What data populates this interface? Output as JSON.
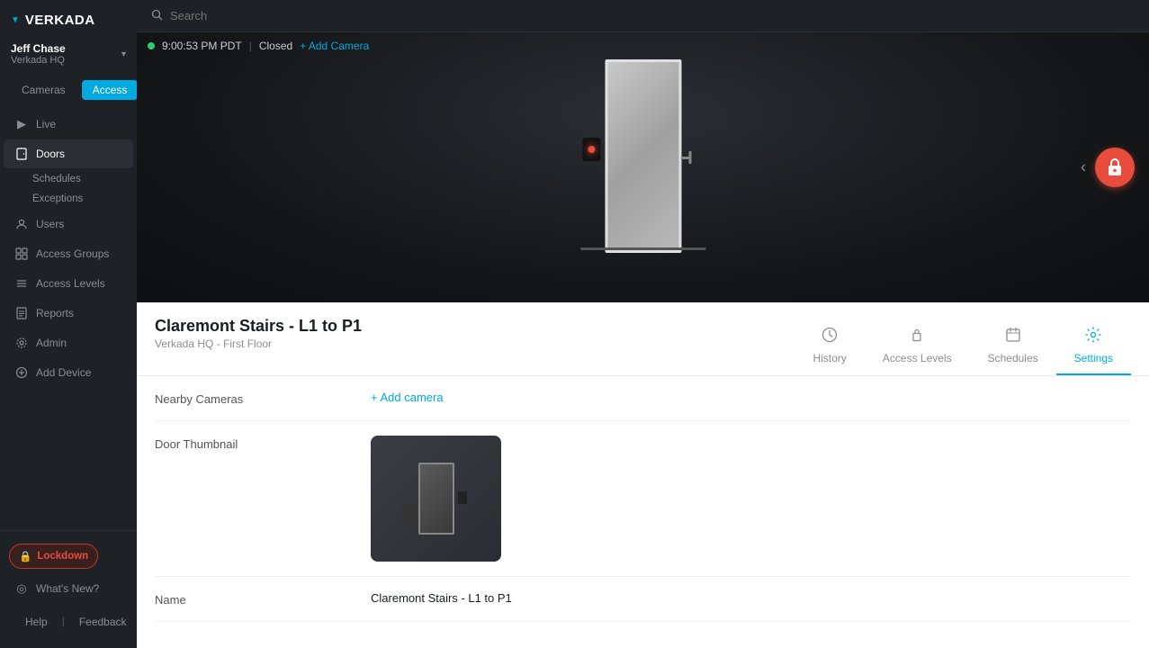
{
  "brand": {
    "name": "VERKADA",
    "logo_symbol": "▼"
  },
  "user": {
    "name": "Jeff Chase",
    "org": "Verkada HQ",
    "chevron": "▾"
  },
  "mode_buttons": {
    "cameras": "Cameras",
    "access": "Access"
  },
  "sidebar": {
    "nav_items": [
      {
        "id": "live",
        "label": "Live",
        "icon": "▶"
      },
      {
        "id": "doors",
        "label": "Doors",
        "icon": "🚪",
        "active": true
      },
      {
        "id": "schedules",
        "label": "Schedules",
        "sub": true
      },
      {
        "id": "exceptions",
        "label": "Exceptions",
        "sub": true
      },
      {
        "id": "users",
        "label": "Users",
        "icon": "👤"
      },
      {
        "id": "access-groups",
        "label": "Access Groups",
        "icon": "⊞"
      },
      {
        "id": "access-levels",
        "label": "Access Levels",
        "icon": "≡"
      },
      {
        "id": "reports",
        "label": "Reports",
        "icon": "📄"
      },
      {
        "id": "admin",
        "label": "Admin",
        "icon": "⚙"
      },
      {
        "id": "add-device",
        "label": "Add Device",
        "icon": "+"
      }
    ],
    "bottom_items": [
      {
        "id": "whats-new",
        "label": "What's New?",
        "icon": "◎"
      },
      {
        "id": "help",
        "label": "Help",
        "icon": "?"
      },
      {
        "id": "feedback",
        "label": "Feedback",
        "icon": "✉"
      }
    ],
    "lockdown_label": "Lockdown"
  },
  "header": {
    "search_placeholder": "Search"
  },
  "status_bar": {
    "time": "9:00:53 PM PDT",
    "separator": "|",
    "status": "Closed",
    "add_camera": "+ Add Camera"
  },
  "detail": {
    "door_name": "Claremont Stairs - L1 to P1",
    "location": "Verkada HQ - First Floor",
    "tabs": [
      {
        "id": "history",
        "label": "History",
        "icon": "🕐"
      },
      {
        "id": "access-levels",
        "label": "Access Levels",
        "icon": "🔒"
      },
      {
        "id": "schedules",
        "label": "Schedules",
        "icon": "📅"
      },
      {
        "id": "settings",
        "label": "Settings",
        "icon": "⚙",
        "active": true
      }
    ],
    "settings": {
      "nearby_cameras_label": "Nearby Cameras",
      "nearby_cameras_action": "+ Add camera",
      "door_thumbnail_label": "Door Thumbnail",
      "name_label": "Name",
      "name_value": "Claremont Stairs - L1 to P1"
    }
  }
}
